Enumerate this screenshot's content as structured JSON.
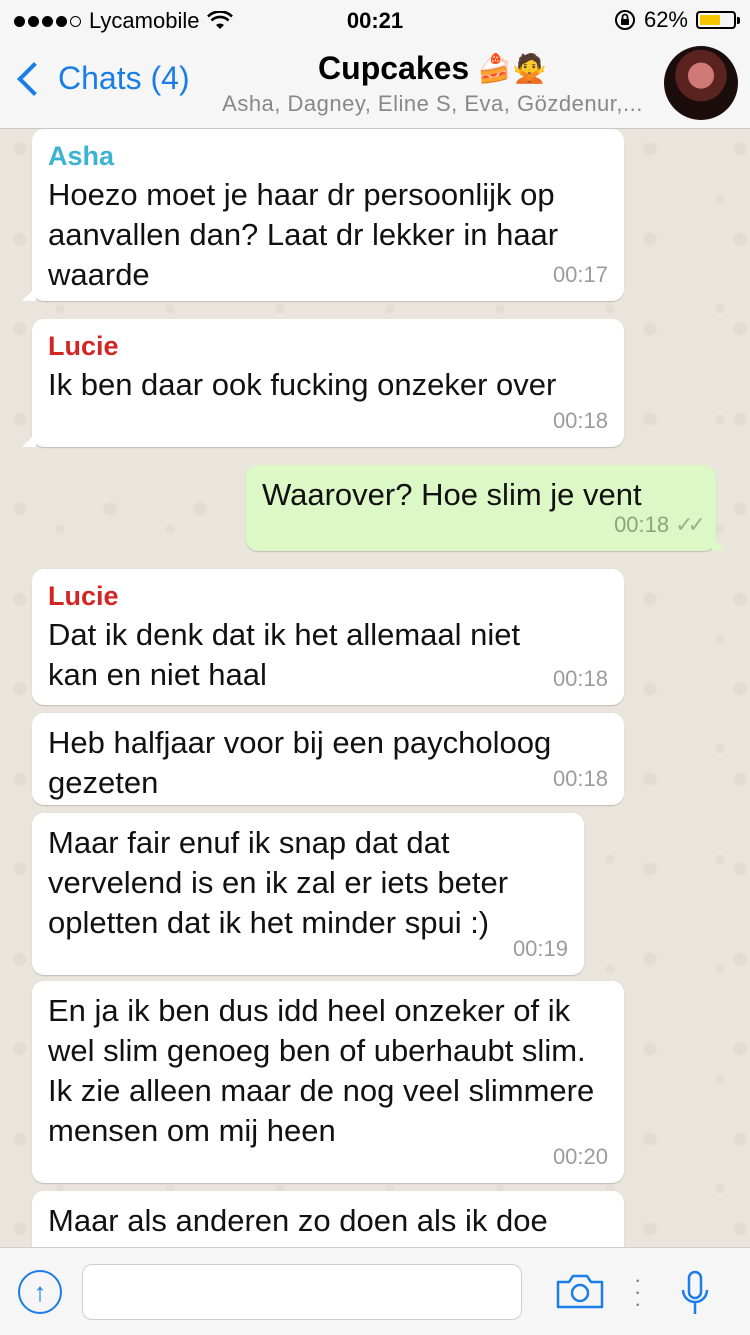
{
  "status_bar": {
    "carrier": "Lycamobile",
    "time": "00:21",
    "battery": "62%",
    "battery_level": 0.62,
    "battery_color": "#f7c500"
  },
  "nav": {
    "back_label": "Chats (4)",
    "title": "Cupcakes",
    "title_emoji": "🍰🙅",
    "subtitle": "Asha, Dagney, Eline S, Eva, Gözdenur,..."
  },
  "colors": {
    "accent": "#1a7ee6",
    "incoming_bubble": "#ffffff",
    "outgoing_bubble": "#dcf8c6",
    "sender_asha": "#3db3d1",
    "sender_lucie": "#d42525"
  },
  "messages": [
    {
      "sender": "Asha",
      "text": "Hoezo moet je haar dr persoonlijk op aanvallen dan? Laat dr lekker in haar waarde",
      "time": "00:17",
      "direction": "in"
    },
    {
      "sender": "Lucie",
      "text": "Ik ben daar ook fucking onzeker over",
      "time": "00:18",
      "direction": "in"
    },
    {
      "sender": "",
      "text": "Waarover? Hoe slim je vent",
      "time": "00:18",
      "direction": "out",
      "ticks": "✓✓"
    },
    {
      "sender": "Lucie",
      "text": "Dat ik denk dat ik het allemaal niet kan en niet haal",
      "time": "00:18",
      "direction": "in"
    },
    {
      "sender": "",
      "text": "Heb halfjaar voor bij een paycholoog gezeten",
      "time": "00:18",
      "direction": "in"
    },
    {
      "sender": "",
      "text": "Maar fair enuf ik snap dat dat vervelend is en ik zal er iets beter opletten dat ik het minder spui :)",
      "time": "00:19",
      "direction": "in"
    },
    {
      "sender": "",
      "text": "En ja ik ben dus idd heel onzeker of ik wel slim genoeg ben of uberhaubt slim. Ik zie alleen maar de nog veel slimmere mensen om mij heen",
      "time": "00:20",
      "direction": "in"
    },
    {
      "sender": "",
      "text": "Maar als anderen zo doen als ik doe",
      "time": "",
      "direction": "in"
    }
  ],
  "input": {
    "placeholder": "",
    "share_icon": "share-arrow-icon",
    "camera_icon": "camera-icon",
    "mic_icon": "microphone-icon"
  }
}
